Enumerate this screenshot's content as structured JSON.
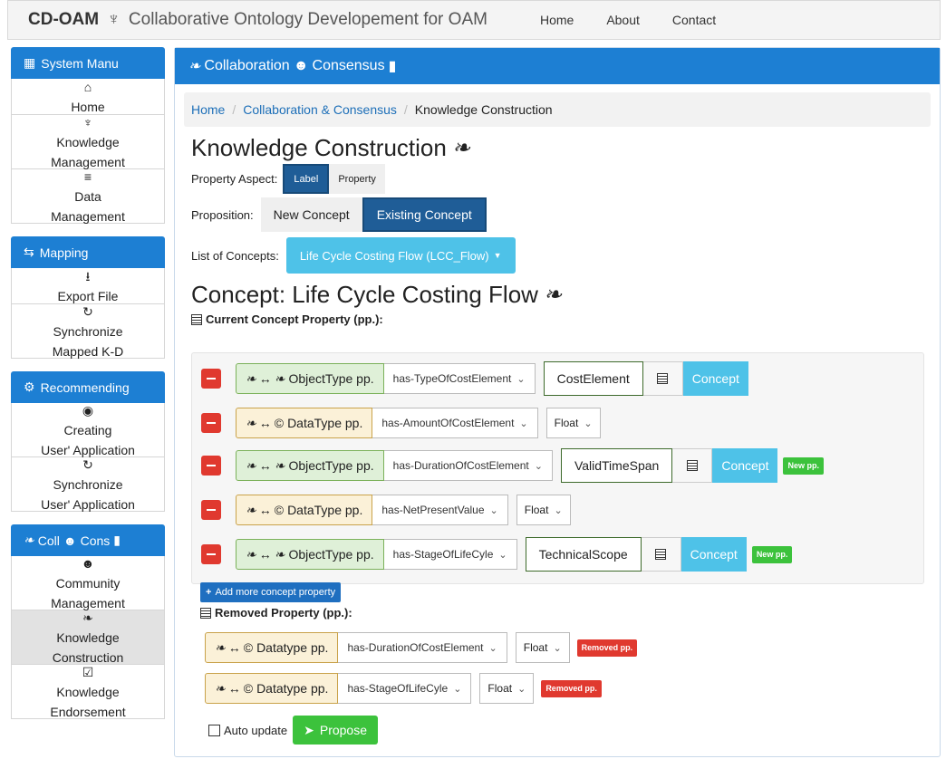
{
  "navbar": {
    "brand": "CD-OAM",
    "brand_symbol": "♆",
    "subtitle": "Collaborative Ontology Developement for OAM",
    "links": [
      "Home",
      "About",
      "Contact"
    ]
  },
  "sidebar": {
    "system": {
      "title": "System Manu",
      "items": [
        {
          "icon": "home-icon",
          "glyph": "⌂",
          "line1": "Home",
          "line2": ""
        },
        {
          "icon": "knowledge-icon",
          "glyph": "♆",
          "line1": "Knowledge",
          "line2": "Management"
        },
        {
          "icon": "data-icon",
          "glyph": "≡",
          "line1": "Data",
          "line2": "Management"
        }
      ]
    },
    "mapping": {
      "title": "Mapping",
      "items": [
        {
          "icon": "export-icon",
          "glyph": "⭳",
          "line1": "Export File",
          "line2": ""
        },
        {
          "icon": "sync-icon",
          "glyph": "↻",
          "line1": "Synchronize",
          "line2": "Mapped K-D"
        }
      ]
    },
    "recommending": {
      "title": "Recommending",
      "items": [
        {
          "icon": "create-icon",
          "glyph": "◉",
          "line1": "Creating",
          "line2": "User' Application"
        },
        {
          "icon": "sync-icon",
          "glyph": "↻",
          "line1": "Synchronize",
          "line2": "User' Application"
        }
      ]
    },
    "coll": {
      "title_a": "Coll",
      "title_b": "Cons",
      "items": [
        {
          "icon": "community-icon",
          "glyph": "☻",
          "line1": "Community",
          "line2": "Management",
          "active": false
        },
        {
          "icon": "leaf-icon",
          "glyph": "❧",
          "line1": "Knowledge",
          "line2": "Construction",
          "active": true
        },
        {
          "icon": "endorse-icon",
          "glyph": "☑",
          "line1": "Knowledge",
          "line2": "Endorsement",
          "active": false
        }
      ]
    }
  },
  "main": {
    "header_a": "Collaboration",
    "header_b": "Consensus",
    "breadcrumb": [
      "Home",
      "Collaboration & Consensus",
      "Knowledge Construction"
    ],
    "title": "Knowledge Construction",
    "property_aspect": {
      "label": "Property Aspect:",
      "options": [
        "Label",
        "Property"
      ],
      "selected": "Label"
    },
    "proposition": {
      "label": "Proposition:",
      "options": [
        "New Concept",
        "Existing Concept"
      ],
      "selected": "Existing Concept"
    },
    "concepts": {
      "label": "List of Concepts:",
      "selected": "Life Cycle Costing Flow (LCC_Flow)"
    },
    "concept_title": "Concept: Life Cycle Costing Flow",
    "current_heading": "Current Concept Property (pp.):",
    "current_props": [
      {
        "kind": "obj",
        "type": "ObjectType pp.",
        "relation": "has-TypeOfCostElement",
        "value": "CostElement",
        "tag": "Concept",
        "badge": ""
      },
      {
        "kind": "dat",
        "type": "DataType pp.",
        "relation": "has-AmountOfCostElement",
        "value": "Float",
        "tag": "",
        "badge": ""
      },
      {
        "kind": "obj",
        "type": "ObjectType pp.",
        "relation": "has-DurationOfCostElement",
        "value": "ValidTimeSpan",
        "tag": "Concept",
        "badge": "New pp."
      },
      {
        "kind": "dat",
        "type": "DataType pp.",
        "relation": "has-NetPresentValue",
        "value": "Float",
        "tag": "",
        "badge": ""
      },
      {
        "kind": "obj",
        "type": "ObjectType pp.",
        "relation": "has-StageOfLifeCyle",
        "value": "TechnicalScope",
        "tag": "Concept",
        "badge": "New pp."
      }
    ],
    "add_button": "Add more concept property",
    "removed_heading": "Removed Property (pp.):",
    "removed_props": [
      {
        "type": "Datatype pp.",
        "relation": "has-DurationOfCostElement",
        "value": "Float",
        "badge": "Removed pp."
      },
      {
        "type": "Datatype pp.",
        "relation": "has-StageOfLifeCyle",
        "value": "Float",
        "badge": "Removed pp."
      }
    ],
    "auto_update": "Auto update",
    "propose": "Propose"
  }
}
